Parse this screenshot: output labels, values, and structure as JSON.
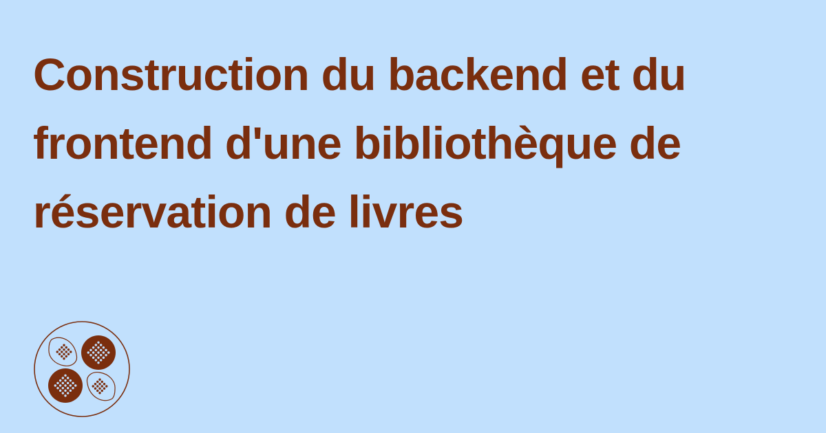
{
  "card": {
    "title": "Construction du backend et du frontend d'une bibliothèque de réservation de livres"
  },
  "logo": {
    "icon": "brand-logo-icon"
  },
  "colors": {
    "background": "#c1e0fd",
    "accent": "#7a2e0e"
  }
}
